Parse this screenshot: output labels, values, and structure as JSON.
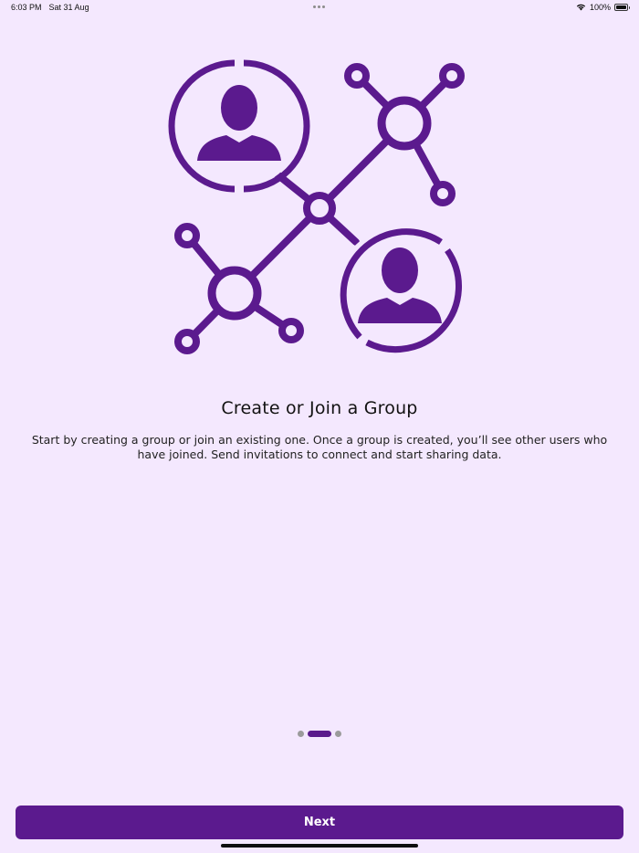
{
  "status_bar": {
    "time": "6:03 PM",
    "date": "Sat 31 Aug",
    "battery_percent": "100%",
    "wifi_icon": "wifi-icon",
    "battery_icon": "battery-icon"
  },
  "onboarding": {
    "illustration_icon": "network-group-icon",
    "title": "Create or Join a Group",
    "description": "Start by creating a group or join an existing one. Once a group is created, you’ll see other users who have joined. Send invitations to connect and start sharing data.",
    "page_indicator": {
      "total": 3,
      "current": 2
    }
  },
  "actions": {
    "next_label": "Next"
  },
  "colors": {
    "background": "#f4e8fe",
    "accent": "#5b1a8e",
    "dot_inactive": "#9b9b9b"
  }
}
